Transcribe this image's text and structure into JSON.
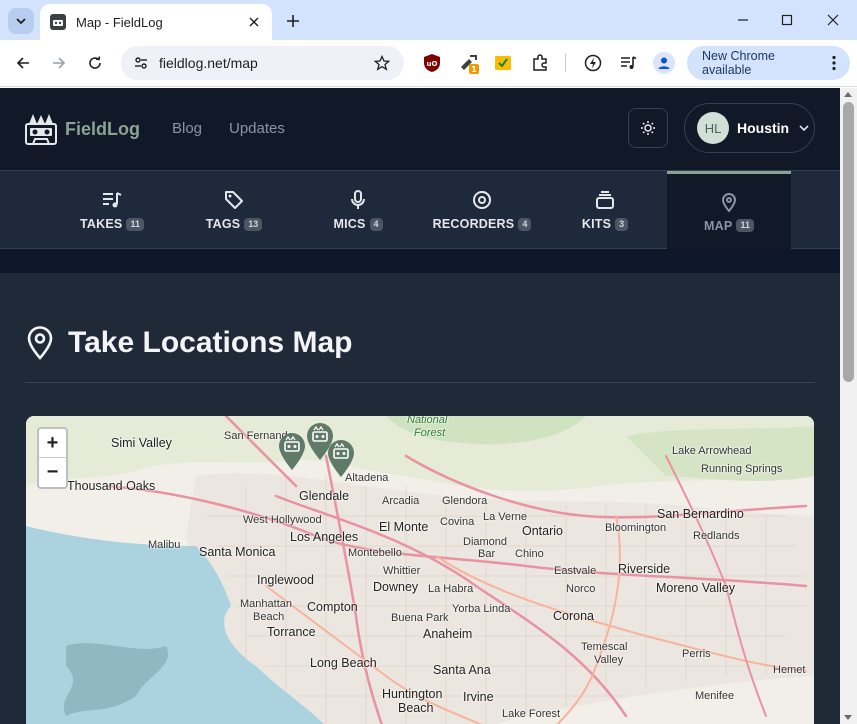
{
  "browser": {
    "tab_title": "Map - FieldLog",
    "url": "fieldlog.net/map",
    "update_label": "New Chrome available",
    "extension_badge": "1"
  },
  "site": {
    "brand": "FieldLog",
    "nav": [
      {
        "label": "Blog"
      },
      {
        "label": "Updates"
      }
    ],
    "user": {
      "initials": "HL",
      "name": "Houstin"
    }
  },
  "tabs": [
    {
      "label": "TAKES",
      "count": "11",
      "icon": "takes-icon"
    },
    {
      "label": "TAGS",
      "count": "13",
      "icon": "tag-icon"
    },
    {
      "label": "MICS",
      "count": "4",
      "icon": "microphone-icon"
    },
    {
      "label": "RECORDERS",
      "count": "4",
      "icon": "recorder-icon"
    },
    {
      "label": "KITS",
      "count": "3",
      "icon": "kits-icon"
    },
    {
      "label": "MAP",
      "count": "11",
      "icon": "map-pin-icon",
      "active": true
    }
  ],
  "page": {
    "title": "Take Locations Map"
  },
  "map": {
    "zoom_in": "+",
    "zoom_out": "−",
    "labels": [
      {
        "text": "National",
        "cls": "park"
      },
      {
        "text": "Forest",
        "cls": "park"
      },
      {
        "text": "Simi Valley",
        "cls": "city"
      },
      {
        "text": "San Fernando",
        "cls": ""
      },
      {
        "text": "Lake Arrowhead",
        "cls": ""
      },
      {
        "text": "Running Springs",
        "cls": ""
      },
      {
        "text": "Altadena",
        "cls": ""
      },
      {
        "text": "Thousand Oaks",
        "cls": "city"
      },
      {
        "text": "Glendale",
        "cls": "city"
      },
      {
        "text": "Arcadia",
        "cls": ""
      },
      {
        "text": "Glendora",
        "cls": ""
      },
      {
        "text": "San Bernardino",
        "cls": "city"
      },
      {
        "text": "West Hollywood",
        "cls": ""
      },
      {
        "text": "El Monte",
        "cls": "city"
      },
      {
        "text": "Covina",
        "cls": ""
      },
      {
        "text": "La Verne",
        "cls": ""
      },
      {
        "text": "Ontario",
        "cls": "city"
      },
      {
        "text": "Bloomington",
        "cls": ""
      },
      {
        "text": "Malibu",
        "cls": ""
      },
      {
        "text": "Los Angeles",
        "cls": "city"
      },
      {
        "text": "Diamond",
        "cls": ""
      },
      {
        "text": "Bar",
        "cls": ""
      },
      {
        "text": "Redlands",
        "cls": ""
      },
      {
        "text": "Santa Monica",
        "cls": "city"
      },
      {
        "text": "Montebello",
        "cls": ""
      },
      {
        "text": "Chino",
        "cls": ""
      },
      {
        "text": "Whittier",
        "cls": ""
      },
      {
        "text": "Eastvale",
        "cls": ""
      },
      {
        "text": "Riverside",
        "cls": "city"
      },
      {
        "text": "Inglewood",
        "cls": "city"
      },
      {
        "text": "Downey",
        "cls": "city"
      },
      {
        "text": "La Habra",
        "cls": ""
      },
      {
        "text": "Norco",
        "cls": ""
      },
      {
        "text": "Moreno Valley",
        "cls": "city"
      },
      {
        "text": "Manhattan",
        "cls": ""
      },
      {
        "text": "Beach",
        "cls": ""
      },
      {
        "text": "Compton",
        "cls": "city"
      },
      {
        "text": "Yorba Linda",
        "cls": ""
      },
      {
        "text": "Buena Park",
        "cls": ""
      },
      {
        "text": "Corona",
        "cls": "city"
      },
      {
        "text": "Torrance",
        "cls": "city"
      },
      {
        "text": "Anaheim",
        "cls": "city"
      },
      {
        "text": "Long Beach",
        "cls": "city"
      },
      {
        "text": "Temescal",
        "cls": ""
      },
      {
        "text": "Valley",
        "cls": ""
      },
      {
        "text": "Perris",
        "cls": ""
      },
      {
        "text": "Santa Ana",
        "cls": "city"
      },
      {
        "text": "Hemet",
        "cls": ""
      },
      {
        "text": "Huntington",
        "cls": "city"
      },
      {
        "text": "Beach",
        "cls": "city"
      },
      {
        "text": "Irvine",
        "cls": "city"
      },
      {
        "text": "Menifee",
        "cls": ""
      },
      {
        "text": "Lake Forest",
        "cls": ""
      }
    ]
  }
}
